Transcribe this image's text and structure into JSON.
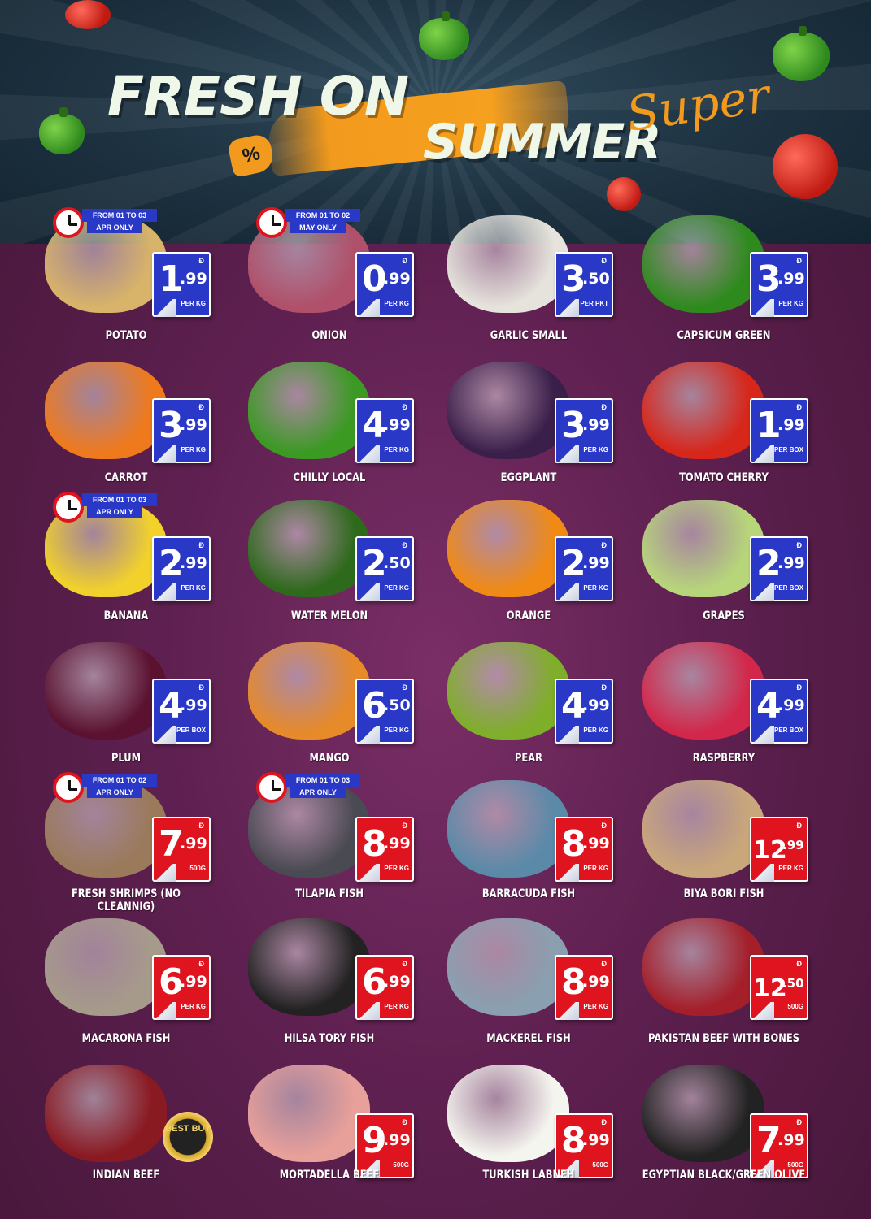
{
  "header": {
    "title_line1": "FRESH ON",
    "title_line2": "SUMMER",
    "script_word": "Super",
    "badge": "%"
  },
  "currency_symbol": "Ð",
  "best_buy": "BEST BUY",
  "products": [
    {
      "name": "POTATO",
      "int": "1",
      "dec": ".99",
      "unit": "PER KG",
      "tag": "blue",
      "promo": [
        "FROM 01 TO 03",
        "APR ONLY"
      ],
      "img": "potato-icon"
    },
    {
      "name": "ONION",
      "int": "0",
      "dec": ".99",
      "unit": "PER KG",
      "tag": "blue",
      "promo": [
        "FROM 01 TO 02",
        "MAY ONLY"
      ],
      "img": "onion-icon"
    },
    {
      "name": "GARLIC SMALL",
      "int": "3",
      "dec": ".50",
      "unit": "PER PKT",
      "tag": "blue",
      "img": "garlic-icon"
    },
    {
      "name": "CAPSICUM GREEN",
      "int": "3",
      "dec": ".99",
      "unit": "PER KG",
      "tag": "blue",
      "img": "capsicum-icon"
    },
    {
      "name": "CARROT",
      "int": "3",
      "dec": ".99",
      "unit": "PER KG",
      "tag": "blue",
      "img": "carrot-icon"
    },
    {
      "name": "CHILLY LOCAL",
      "int": "4",
      "dec": ".99",
      "unit": "PER KG",
      "tag": "blue",
      "img": "chilly-icon"
    },
    {
      "name": "EGGPLANT",
      "int": "3",
      "dec": ".99",
      "unit": "PER KG",
      "tag": "blue",
      "img": "eggplant-icon"
    },
    {
      "name": "TOMATO CHERRY",
      "int": "1",
      "dec": ".99",
      "unit": "PER BOX",
      "tag": "blue",
      "img": "tomato-cherry-icon"
    },
    {
      "name": "BANANA",
      "int": "2",
      "dec": ".99",
      "unit": "PER KG",
      "tag": "blue",
      "promo": [
        "FROM 01 TO 03",
        "APR ONLY"
      ],
      "img": "banana-icon"
    },
    {
      "name": "WATER MELON",
      "int": "2",
      "dec": ".50",
      "unit": "PER KG",
      "tag": "blue",
      "img": "watermelon-icon"
    },
    {
      "name": "ORANGE",
      "int": "2",
      "dec": ".99",
      "unit": "PER KG",
      "tag": "blue",
      "img": "orange-icon"
    },
    {
      "name": "GRAPES",
      "int": "2",
      "dec": ".99",
      "unit": "PER BOX",
      "tag": "blue",
      "img": "grapes-icon"
    },
    {
      "name": "PLUM",
      "int": "4",
      "dec": ".99",
      "unit": "PER BOX",
      "tag": "blue",
      "img": "plum-icon"
    },
    {
      "name": "MANGO",
      "int": "6",
      "dec": ".50",
      "unit": "PER KG",
      "tag": "blue",
      "img": "mango-icon"
    },
    {
      "name": "PEAR",
      "int": "4",
      "dec": ".99",
      "unit": "PER KG",
      "tag": "blue",
      "img": "pear-icon"
    },
    {
      "name": "RASPBERRY",
      "int": "4",
      "dec": ".99",
      "unit": "PER BOX",
      "tag": "blue",
      "img": "raspberry-icon"
    },
    {
      "name": "FRESH SHRIMPS (NO CLEANNIG)",
      "int": "7",
      "dec": ".99",
      "unit": "500G",
      "tag": "red",
      "promo": [
        "FROM 01 TO 02",
        "APR ONLY"
      ],
      "img": "shrimp-icon"
    },
    {
      "name": "TILAPIA FISH",
      "int": "8",
      "dec": ".99",
      "unit": "PER KG",
      "tag": "red",
      "promo": [
        "FROM 01 TO 03",
        "APR ONLY"
      ],
      "img": "tilapia-icon"
    },
    {
      "name": "BARRACUDA FISH",
      "int": "8",
      "dec": ".99",
      "unit": "PER KG",
      "tag": "red",
      "img": "barracuda-icon"
    },
    {
      "name": "BIYA BORI FISH",
      "int": "12",
      "dec": ".99",
      "unit": "PER KG",
      "tag": "red",
      "img": "biya-bori-icon"
    },
    {
      "name": "MACARONA FISH",
      "int": "6",
      "dec": ".99",
      "unit": "PER KG",
      "tag": "red",
      "img": "macarona-icon"
    },
    {
      "name": "HILSA TORY FISH",
      "int": "6",
      "dec": ".99",
      "unit": "PER KG",
      "tag": "red",
      "img": "hilsa-icon"
    },
    {
      "name": "MACKEREL FISH",
      "int": "8",
      "dec": ".99",
      "unit": "PER KG",
      "tag": "red",
      "img": "mackerel-icon"
    },
    {
      "name": "PAKISTAN BEEF WITH BONES",
      "int": "12",
      "dec": ".50",
      "unit": "500G",
      "tag": "red",
      "img": "beef-bones-icon"
    },
    {
      "name": "INDIAN BEEF",
      "int": "",
      "dec": "",
      "unit": "",
      "tag": "none",
      "img": "indian-beef-icon"
    },
    {
      "name": "MORTADELLA  BEEF",
      "int": "9",
      "dec": ".99",
      "unit": "500G",
      "tag": "red",
      "img": "mortadella-icon"
    },
    {
      "name": "TURKISH LABNEH",
      "int": "8",
      "dec": ".99",
      "unit": "500G",
      "tag": "red",
      "img": "labneh-icon"
    },
    {
      "name": "EGYPTIAN BLACK/GREEN OLIVE",
      "int": "7",
      "dec": ".99",
      "unit": "500G",
      "tag": "red",
      "img": "olive-icon"
    }
  ],
  "colors": {
    "blue_tag": "#2a38c8",
    "red_tag": "#e0141e",
    "accent_orange": "#f29a1d",
    "background_purple": "#5e2050"
  }
}
